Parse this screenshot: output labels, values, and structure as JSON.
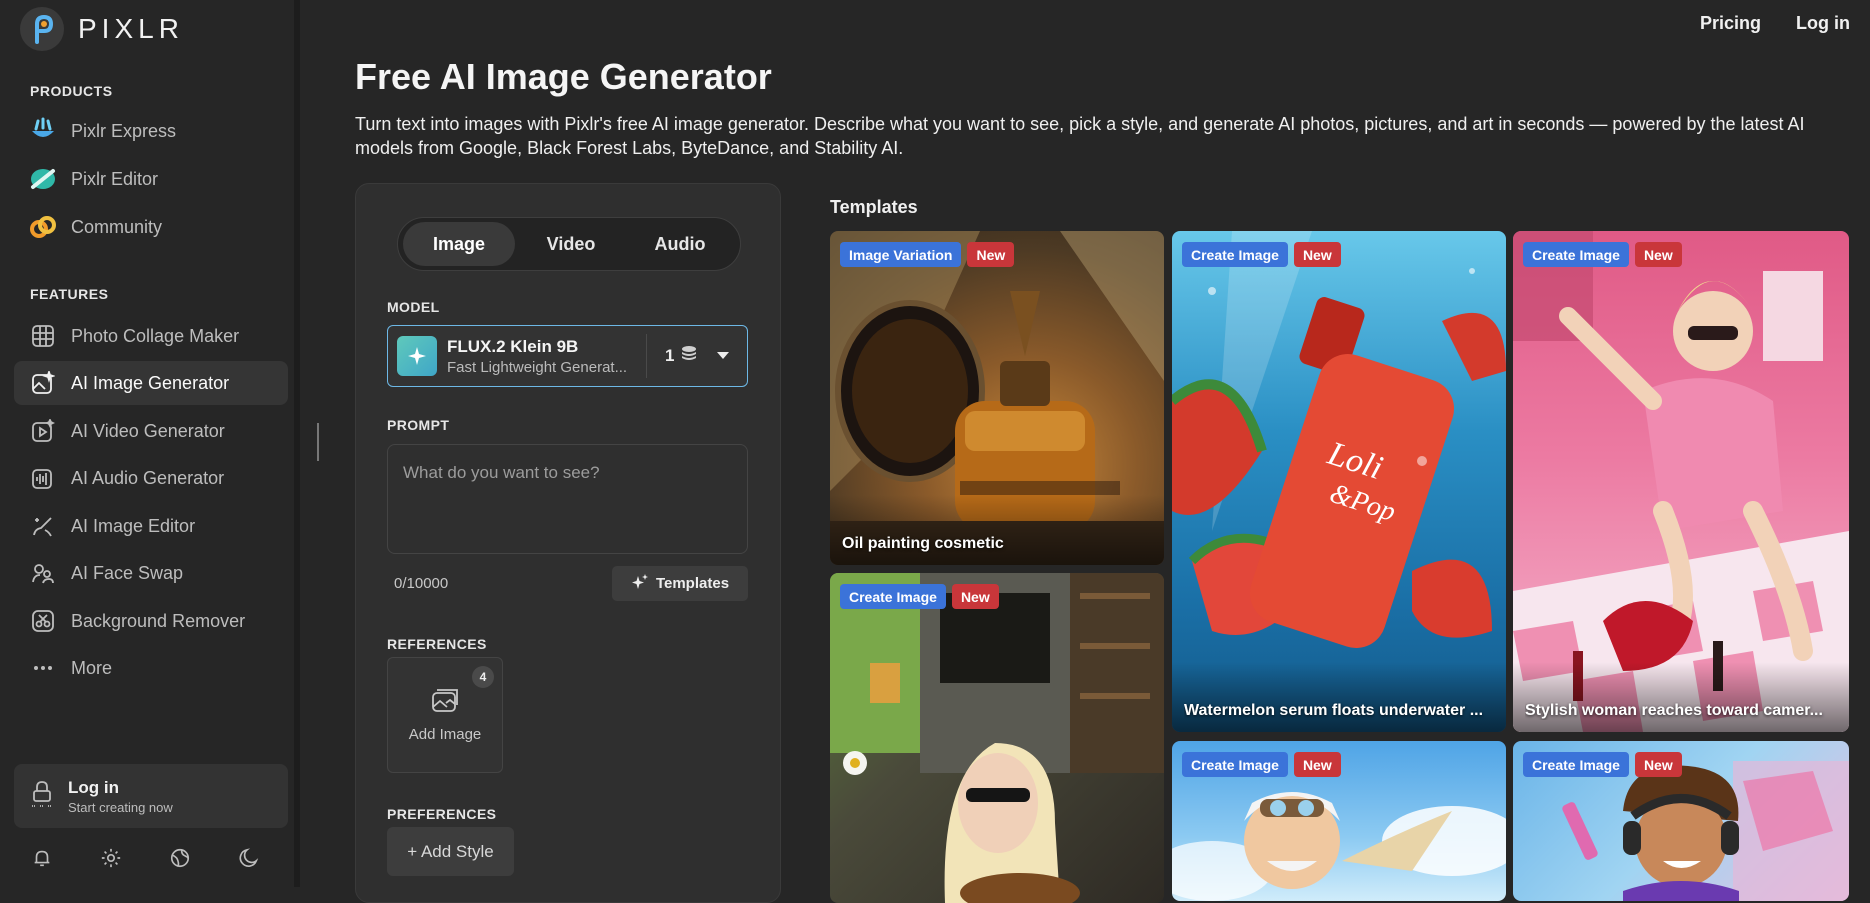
{
  "brand": {
    "name": "PIXLR"
  },
  "topnav": {
    "pricing": "Pricing",
    "login": "Log in"
  },
  "sidebar": {
    "products_heading": "PRODUCTS",
    "products": [
      {
        "label": "Pixlr Express",
        "icon": "express-icon"
      },
      {
        "label": "Pixlr Editor",
        "icon": "editor-icon"
      },
      {
        "label": "Community",
        "icon": "community-icon"
      }
    ],
    "features_heading": "FEATURES",
    "features": [
      {
        "label": "Photo Collage Maker",
        "icon": "collage-icon"
      },
      {
        "label": "AI Image Generator",
        "icon": "image-generator-icon",
        "active": true
      },
      {
        "label": "AI Video Generator",
        "icon": "video-generator-icon"
      },
      {
        "label": "AI Audio Generator",
        "icon": "audio-generator-icon"
      },
      {
        "label": "AI Image Editor",
        "icon": "image-editor-icon"
      },
      {
        "label": "AI Face Swap",
        "icon": "face-swap-icon"
      },
      {
        "label": "Background Remover",
        "icon": "background-remover-icon"
      },
      {
        "label": "More",
        "icon": "more-icon"
      }
    ],
    "login": {
      "title": "Log in",
      "subtitle": "Start creating now"
    },
    "bottom_icons": [
      "bell-icon",
      "gear-icon",
      "globe-icon",
      "moon-icon"
    ]
  },
  "main": {
    "title": "Free AI Image Generator",
    "intro": "Turn text into images with Pixlr's free AI image generator. Describe what you want to see, pick a style, and generate AI photos, pictures, and art in seconds — powered by the latest AI models from Google, Black Forest Labs, ByteDance, and Stability AI."
  },
  "panel": {
    "tabs": [
      "Image",
      "Video",
      "Audio"
    ],
    "active_tab": "Image",
    "model_label": "MODEL",
    "model": {
      "name": "FLUX.2 Klein 9B",
      "description": "Fast Lightweight Generat...",
      "count": "1"
    },
    "prompt_label": "PROMPT",
    "prompt_placeholder": "What do you want to see?",
    "counter": "0/10000",
    "templates_button": "Templates",
    "references_label": "REFERENCES",
    "add_image": "Add Image",
    "reference_badge": "4",
    "preferences_label": "PREFERENCES",
    "add_style": "+ Add Style"
  },
  "templates": {
    "title": "Templates",
    "cards": [
      {
        "tag": "Image Variation",
        "badge": "New",
        "caption": "Oil painting cosmetic"
      },
      {
        "tag": "Create Image",
        "badge": "New",
        "caption": "Watermelon serum floats underwater ..."
      },
      {
        "tag": "Create Image",
        "badge": "New",
        "caption": "Stylish woman reaches toward camer..."
      },
      {
        "tag": "Create Image",
        "badge": "New",
        "caption": ""
      },
      {
        "tag": "Create Image",
        "badge": "New",
        "caption": ""
      },
      {
        "tag": "Create Image",
        "badge": "New",
        "caption": ""
      }
    ]
  },
  "colors": {
    "accent_blue": "#3b73d9",
    "badge_red": "#c9363a",
    "model_border": "#6db8e6"
  }
}
